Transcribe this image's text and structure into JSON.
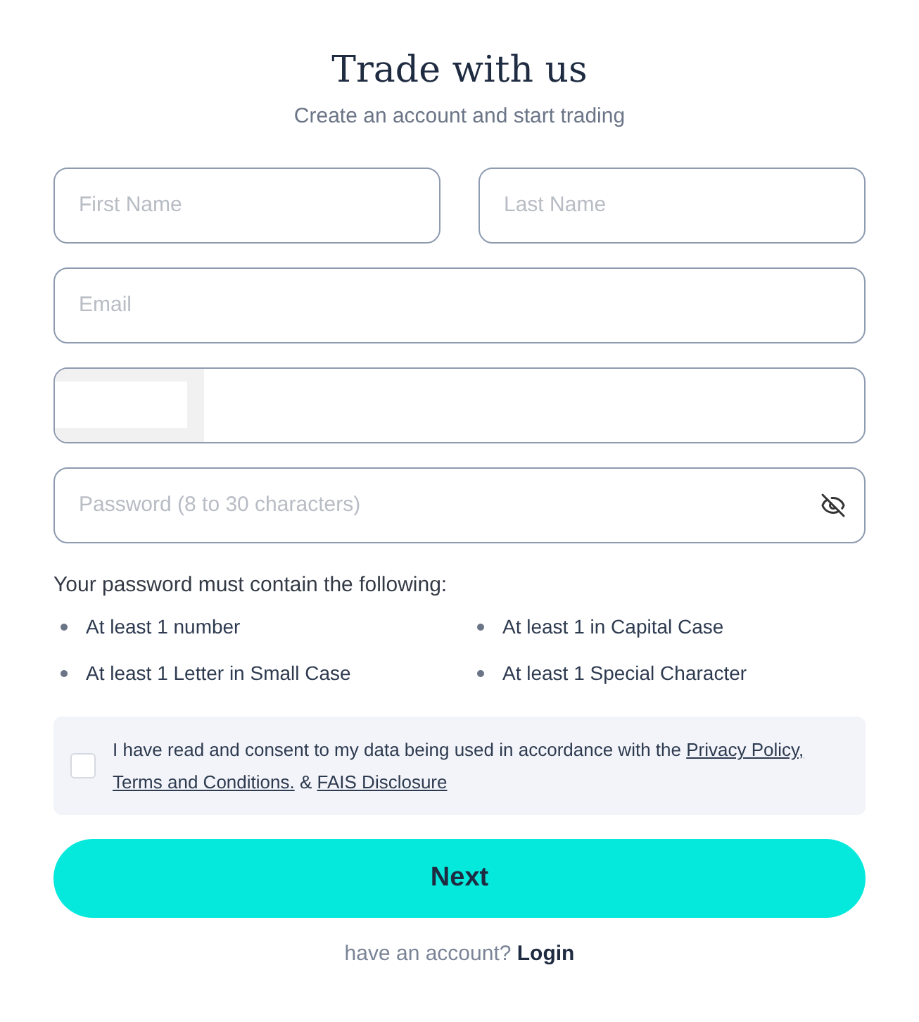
{
  "header": {
    "title": "Trade with us",
    "subtitle": "Create an account and start trading"
  },
  "name_fields": [
    {
      "placeholder": "First Name"
    },
    {
      "placeholder": "Last Name"
    }
  ],
  "email": {
    "placeholder": "Email"
  },
  "phone": {
    "country_selector": {
      "kind": "blank"
    }
  },
  "password": {
    "placeholder": "Password (8 to 30 characters)",
    "visible": false
  },
  "requirements": {
    "heading": "Your password must contain the following:",
    "items": [
      "At least 1 number",
      "At least 1 in Capital Case",
      "At least 1 Letter in Small Case",
      "At least 1 Special Character"
    ]
  },
  "consent": {
    "checked": false,
    "text": "I have read and consent to my data being used in accordance with the",
    "links": [
      "Privacy Policy,",
      "Terms and Conditions.",
      "FAIS Disclosure"
    ],
    "joiner": "&"
  },
  "next_button": "Next",
  "footer": {
    "text": "have an account?",
    "link": "Login"
  }
}
